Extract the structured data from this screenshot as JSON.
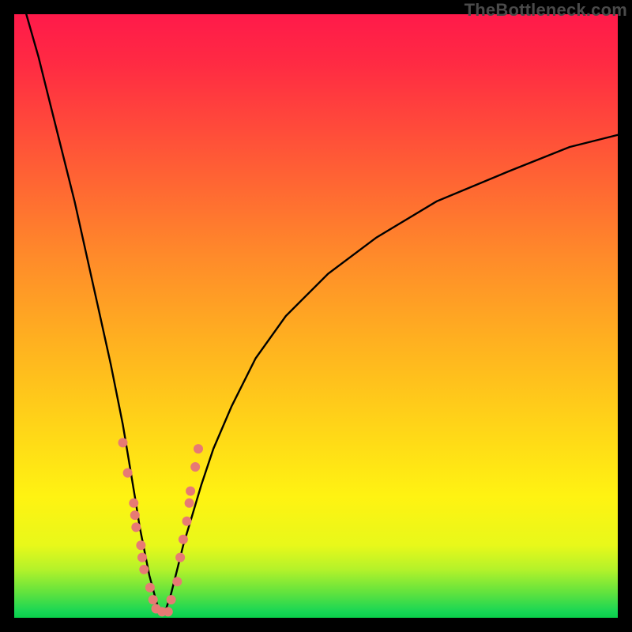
{
  "watermark": "TheBottleneck.com",
  "chart_data": {
    "type": "line",
    "title": "",
    "xlabel": "",
    "ylabel": "",
    "xlim": [
      0,
      100
    ],
    "ylim": [
      0,
      100
    ],
    "note": "Values are estimated from pixel positions; the chart has no visible axes, tick labels, or legend. x ≈ horizontal position (0–100 left→right), y ≈ 100 − normalized bottleneck (0 at bottom/green, 100 at top/red).",
    "series": [
      {
        "name": "left-branch",
        "x": [
          2,
          4,
          6,
          8,
          10,
          12,
          14,
          16,
          18,
          19,
          20,
          20.8,
          21.6,
          22.4,
          23.2,
          24
        ],
        "y": [
          100,
          93,
          85,
          77,
          69,
          60,
          51,
          42,
          32,
          26,
          20,
          15,
          11,
          7,
          4,
          1
        ]
      },
      {
        "name": "right-branch",
        "x": [
          25,
          26,
          27,
          28,
          29.5,
          31,
          33,
          36,
          40,
          45,
          52,
          60,
          70,
          82,
          92,
          100
        ],
        "y": [
          1,
          4,
          8,
          12,
          17,
          22,
          28,
          35,
          43,
          50,
          57,
          63,
          69,
          74,
          78,
          80
        ]
      }
    ],
    "markers": {
      "name": "highlighted-points",
      "description": "salmon dots near the curve minimum / lower yellow-green band",
      "points": [
        {
          "x": 18.0,
          "y": 29
        },
        {
          "x": 18.8,
          "y": 24
        },
        {
          "x": 19.8,
          "y": 19
        },
        {
          "x": 20.0,
          "y": 17
        },
        {
          "x": 20.2,
          "y": 15
        },
        {
          "x": 21.0,
          "y": 12
        },
        {
          "x": 21.2,
          "y": 10
        },
        {
          "x": 21.5,
          "y": 8
        },
        {
          "x": 22.5,
          "y": 5
        },
        {
          "x": 23.0,
          "y": 3
        },
        {
          "x": 23.5,
          "y": 1.5
        },
        {
          "x": 24.5,
          "y": 1
        },
        {
          "x": 25.5,
          "y": 1
        },
        {
          "x": 26.0,
          "y": 3
        },
        {
          "x": 27.0,
          "y": 6
        },
        {
          "x": 27.5,
          "y": 10
        },
        {
          "x": 28.0,
          "y": 13
        },
        {
          "x": 28.6,
          "y": 16
        },
        {
          "x": 29.0,
          "y": 19
        },
        {
          "x": 29.2,
          "y": 21
        },
        {
          "x": 30.0,
          "y": 25
        },
        {
          "x": 30.5,
          "y": 28
        }
      ]
    },
    "gradient_stops": [
      {
        "pos": 0.0,
        "color": "#ff1a4a"
      },
      {
        "pos": 0.4,
        "color": "#ff8a2a"
      },
      {
        "pos": 0.8,
        "color": "#fff312"
      },
      {
        "pos": 0.96,
        "color": "#5de23f"
      },
      {
        "pos": 1.0,
        "color": "#0ad04a"
      }
    ]
  }
}
